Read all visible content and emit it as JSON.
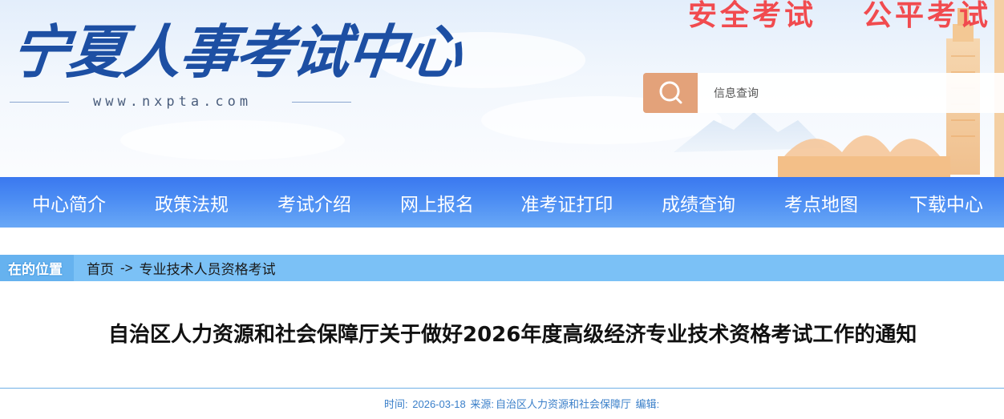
{
  "header": {
    "logo_text": "宁夏人事考试中心",
    "site_url": "www.nxpta.com",
    "slogans": [
      "安全考试",
      "公平考试"
    ],
    "search": {
      "placeholder": "信息查询",
      "icon": "search-icon"
    }
  },
  "nav": {
    "items": [
      {
        "label": "中心简介"
      },
      {
        "label": "政策法规"
      },
      {
        "label": "考试介绍"
      },
      {
        "label": "网上报名"
      },
      {
        "label": "准考证打印"
      },
      {
        "label": "成绩查询"
      },
      {
        "label": "考点地图"
      },
      {
        "label": "下载中心"
      }
    ]
  },
  "breadcrumb": {
    "tag": "在的位置",
    "home": "首页",
    "separator": "->",
    "current": "专业技术人员资格考试"
  },
  "article": {
    "title": "自治区人力资源和社会保障厅关于做好2026年度高级经济专业技术资格考试工作的通知",
    "meta": {
      "time_label": "时间:",
      "time_value": "2026-03-18",
      "source_label": "来源:",
      "source_value": "自治区人力资源和社会保障厅",
      "editor_label": "编辑:"
    }
  },
  "colors": {
    "nav_top": "#3a78f0",
    "nav_bottom": "#69a8f6",
    "slogan": "#f14b4f",
    "search_button": "#e3a27a",
    "breadcrumb_bar": "#7bc1f6",
    "meta_text": "#3a7fc9"
  }
}
